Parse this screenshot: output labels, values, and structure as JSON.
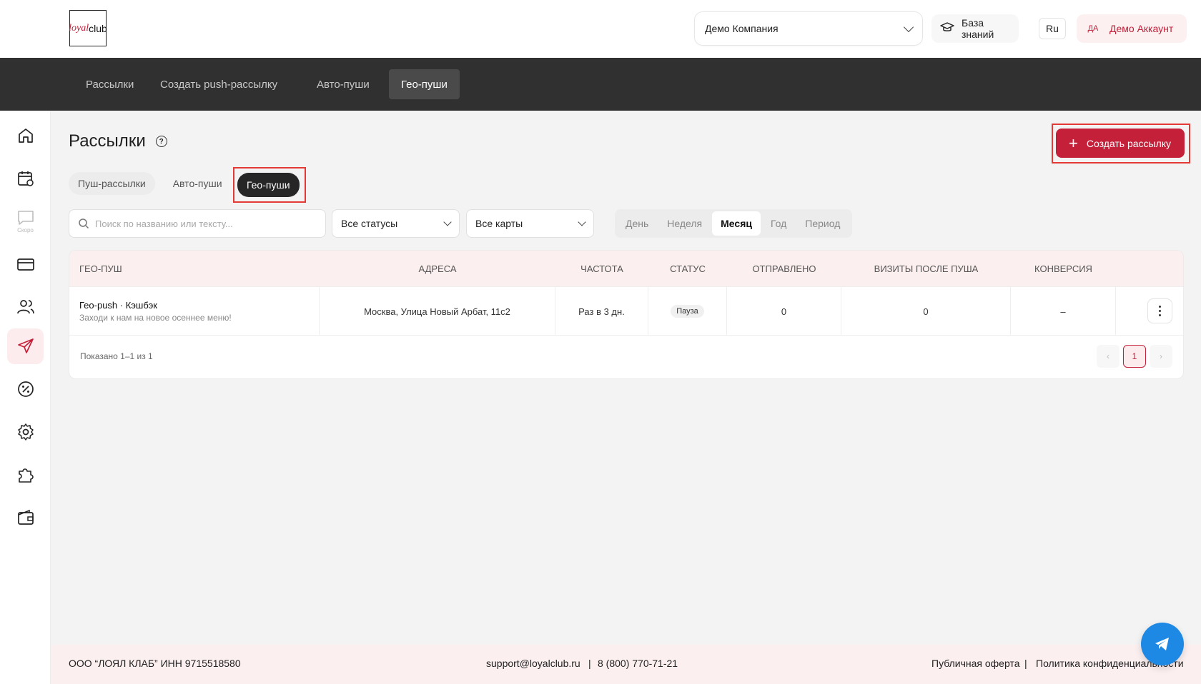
{
  "header": {
    "logo": {
      "part1": "loyal",
      "part2": "club"
    },
    "company": "Демо Компания",
    "knowledge_base": "База знаний",
    "lang": "Ru",
    "account_initials": "ДА",
    "account_name": "Демо Аккаунт"
  },
  "topnav": [
    "Рассылки",
    "Создать push-рассылку",
    "Авто-пуши",
    "Гео-пуши"
  ],
  "topnav_active": "Гео-пуши",
  "sidebar": {
    "icons": [
      "home-icon",
      "calendar-icon",
      "chat-icon",
      "card-icon",
      "users-icon",
      "send-icon",
      "discount-icon",
      "settings-icon",
      "puzzle-icon",
      "wallet-icon"
    ],
    "soon_label": "Скоро",
    "active": "send-icon"
  },
  "page": {
    "title": "Рассылки",
    "create_button": "Создать рассылку",
    "subtabs": [
      "Пуш-рассылки",
      "Авто-пуши",
      "Гео-пуши"
    ],
    "active_subtab": "Гео-пуши",
    "search_placeholder": "Поиск по названию или тексту...",
    "status_filter": "Все статусы",
    "cards_filter": "Все карты",
    "periods": [
      "День",
      "Неделя",
      "Месяц",
      "Год",
      "Период"
    ],
    "active_period": "Месяц"
  },
  "table": {
    "columns": [
      "ГЕО-ПУШ",
      "АДРЕСА",
      "ЧАСТОТА",
      "СТАТУС",
      "ОТПРАВЛЕНО",
      "ВИЗИТЫ ПОСЛЕ ПУША",
      "КОНВЕРСИЯ"
    ],
    "rows": [
      {
        "name": "Гео-push · Кэшбэк",
        "text": "Заходи к нам на новое осеннее меню!",
        "address": "Москва, Улица Новый Арбат, 11с2",
        "frequency": "Раз в 3 дн.",
        "status": "Пауза",
        "sent": "0",
        "visits": "0",
        "conversion": "–"
      }
    ],
    "shown": "Показано 1–1 из 1",
    "page": "1"
  },
  "footer": {
    "company": "ООО “ЛОЯЛ КЛАБ” ИНН 9715518580",
    "email": "support@loyalclub.ru",
    "sep": "|",
    "phone": "8 (800) 770-71-21",
    "offer": "Публичная оферта",
    "privacy": "Политика конфиденциальности"
  },
  "colors": {
    "accent": "#c5203a",
    "dark": "#303030",
    "telegram": "#1e88e5"
  }
}
